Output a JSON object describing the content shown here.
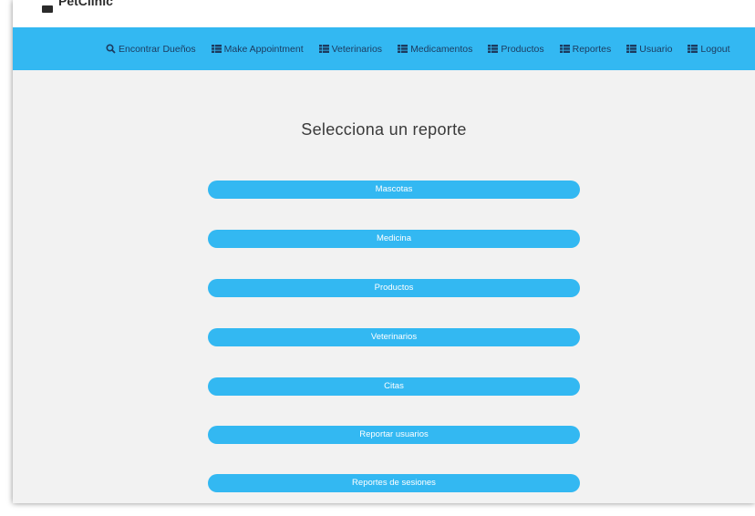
{
  "brand": {
    "name": "PetClinic"
  },
  "nav": {
    "items": [
      {
        "label": "Encontrar Dueños",
        "icon": "search-icon"
      },
      {
        "label": "Make Appointment",
        "icon": "list-icon"
      },
      {
        "label": "Veterinarios",
        "icon": "list-icon"
      },
      {
        "label": "Medicamentos",
        "icon": "list-icon"
      },
      {
        "label": "Productos",
        "icon": "list-icon"
      },
      {
        "label": "Reportes",
        "icon": "list-icon"
      },
      {
        "label": "Usuario",
        "icon": "list-icon"
      },
      {
        "label": "Logout",
        "icon": "list-icon"
      }
    ]
  },
  "main": {
    "title": "Selecciona un reporte",
    "buttons": [
      "Mascotas",
      "Medicina",
      "Productos",
      "Veterinarios",
      "Citas",
      "Reportar usuarios",
      "Reportes de sesiones"
    ]
  },
  "colors": {
    "accent": "#33b8f2",
    "nav_text": "#1c3a5e",
    "background": "#f2f2f2"
  }
}
